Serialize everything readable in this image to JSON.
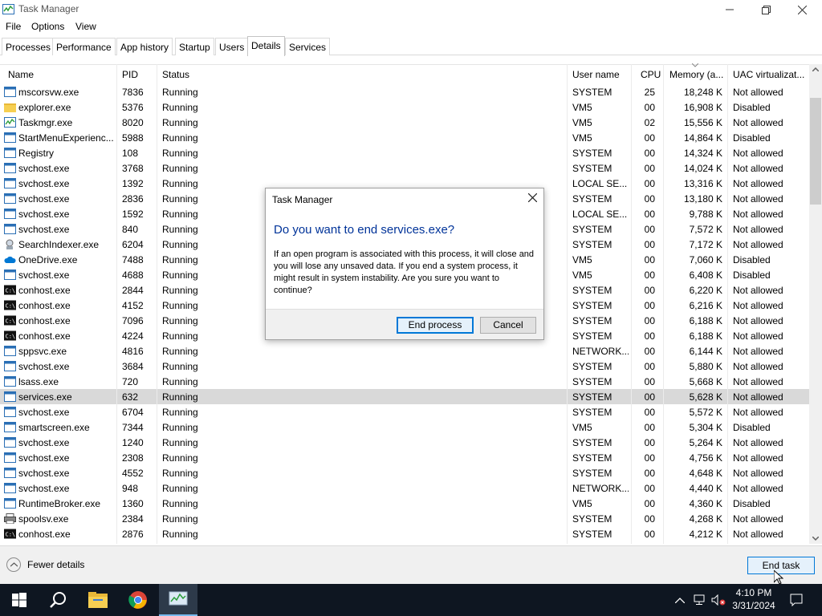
{
  "window": {
    "title": "Task Manager"
  },
  "menu": [
    "File",
    "Options",
    "View"
  ],
  "tabs": [
    "Processes",
    "Performance",
    "App history",
    "Startup",
    "Users",
    "Details",
    "Services"
  ],
  "active_tab": "Details",
  "columns": {
    "name": "Name",
    "pid": "PID",
    "status": "Status",
    "user": "User name",
    "cpu": "CPU",
    "memory": "Memory (a...",
    "uac": "UAC virtualizat..."
  },
  "rows": [
    {
      "icon": "app",
      "name": "mscorsvw.exe",
      "pid": "7836",
      "status": "Running",
      "user": "SYSTEM",
      "cpu": "25",
      "mem": "18,248 K",
      "uac": "Not allowed"
    },
    {
      "icon": "folder",
      "name": "explorer.exe",
      "pid": "5376",
      "status": "Running",
      "user": "VM5",
      "cpu": "00",
      "mem": "16,908 K",
      "uac": "Disabled"
    },
    {
      "icon": "taskmgr",
      "name": "Taskmgr.exe",
      "pid": "8020",
      "status": "Running",
      "user": "VM5",
      "cpu": "02",
      "mem": "15,556 K",
      "uac": "Not allowed"
    },
    {
      "icon": "app",
      "name": "StartMenuExperienc...",
      "pid": "5988",
      "status": "Running",
      "user": "VM5",
      "cpu": "00",
      "mem": "14,864 K",
      "uac": "Disabled"
    },
    {
      "icon": "app",
      "name": "Registry",
      "pid": "108",
      "status": "Running",
      "user": "SYSTEM",
      "cpu": "00",
      "mem": "14,324 K",
      "uac": "Not allowed"
    },
    {
      "icon": "app",
      "name": "svchost.exe",
      "pid": "3768",
      "status": "Running",
      "user": "SYSTEM",
      "cpu": "00",
      "mem": "14,024 K",
      "uac": "Not allowed"
    },
    {
      "icon": "app",
      "name": "svchost.exe",
      "pid": "1392",
      "status": "Running",
      "user": "LOCAL SE...",
      "cpu": "00",
      "mem": "13,316 K",
      "uac": "Not allowed"
    },
    {
      "icon": "app",
      "name": "svchost.exe",
      "pid": "2836",
      "status": "Running",
      "user": "SYSTEM",
      "cpu": "00",
      "mem": "13,180 K",
      "uac": "Not allowed"
    },
    {
      "icon": "app",
      "name": "svchost.exe",
      "pid": "1592",
      "status": "Running",
      "user": "LOCAL SE...",
      "cpu": "00",
      "mem": "9,788 K",
      "uac": "Not allowed"
    },
    {
      "icon": "app",
      "name": "svchost.exe",
      "pid": "840",
      "status": "Running",
      "user": "SYSTEM",
      "cpu": "00",
      "mem": "7,572 K",
      "uac": "Not allowed"
    },
    {
      "icon": "search",
      "name": "SearchIndexer.exe",
      "pid": "6204",
      "status": "Running",
      "user": "SYSTEM",
      "cpu": "00",
      "mem": "7,172 K",
      "uac": "Not allowed"
    },
    {
      "icon": "cloud",
      "name": "OneDrive.exe",
      "pid": "7488",
      "status": "Running",
      "user": "VM5",
      "cpu": "00",
      "mem": "7,060 K",
      "uac": "Disabled"
    },
    {
      "icon": "app",
      "name": "svchost.exe",
      "pid": "4688",
      "status": "Running",
      "user": "VM5",
      "cpu": "00",
      "mem": "6,408 K",
      "uac": "Disabled"
    },
    {
      "icon": "console",
      "name": "conhost.exe",
      "pid": "2844",
      "status": "Running",
      "user": "SYSTEM",
      "cpu": "00",
      "mem": "6,220 K",
      "uac": "Not allowed"
    },
    {
      "icon": "console",
      "name": "conhost.exe",
      "pid": "4152",
      "status": "Running",
      "user": "SYSTEM",
      "cpu": "00",
      "mem": "6,216 K",
      "uac": "Not allowed"
    },
    {
      "icon": "console",
      "name": "conhost.exe",
      "pid": "7096",
      "status": "Running",
      "user": "SYSTEM",
      "cpu": "00",
      "mem": "6,188 K",
      "uac": "Not allowed"
    },
    {
      "icon": "console",
      "name": "conhost.exe",
      "pid": "4224",
      "status": "Running",
      "user": "SYSTEM",
      "cpu": "00",
      "mem": "6,188 K",
      "uac": "Not allowed"
    },
    {
      "icon": "app",
      "name": "sppsvc.exe",
      "pid": "4816",
      "status": "Running",
      "user": "NETWORK...",
      "cpu": "00",
      "mem": "6,144 K",
      "uac": "Not allowed"
    },
    {
      "icon": "app",
      "name": "svchost.exe",
      "pid": "3684",
      "status": "Running",
      "user": "SYSTEM",
      "cpu": "00",
      "mem": "5,880 K",
      "uac": "Not allowed"
    },
    {
      "icon": "app",
      "name": "lsass.exe",
      "pid": "720",
      "status": "Running",
      "user": "SYSTEM",
      "cpu": "00",
      "mem": "5,668 K",
      "uac": "Not allowed"
    },
    {
      "icon": "app",
      "name": "services.exe",
      "pid": "632",
      "status": "Running",
      "user": "SYSTEM",
      "cpu": "00",
      "mem": "5,628 K",
      "uac": "Not allowed",
      "selected": true
    },
    {
      "icon": "app",
      "name": "svchost.exe",
      "pid": "6704",
      "status": "Running",
      "user": "SYSTEM",
      "cpu": "00",
      "mem": "5,572 K",
      "uac": "Not allowed"
    },
    {
      "icon": "app",
      "name": "smartscreen.exe",
      "pid": "7344",
      "status": "Running",
      "user": "VM5",
      "cpu": "00",
      "mem": "5,304 K",
      "uac": "Disabled"
    },
    {
      "icon": "app",
      "name": "svchost.exe",
      "pid": "1240",
      "status": "Running",
      "user": "SYSTEM",
      "cpu": "00",
      "mem": "5,264 K",
      "uac": "Not allowed"
    },
    {
      "icon": "app",
      "name": "svchost.exe",
      "pid": "2308",
      "status": "Running",
      "user": "SYSTEM",
      "cpu": "00",
      "mem": "4,756 K",
      "uac": "Not allowed"
    },
    {
      "icon": "app",
      "name": "svchost.exe",
      "pid": "4552",
      "status": "Running",
      "user": "SYSTEM",
      "cpu": "00",
      "mem": "4,648 K",
      "uac": "Not allowed"
    },
    {
      "icon": "app",
      "name": "svchost.exe",
      "pid": "948",
      "status": "Running",
      "user": "NETWORK...",
      "cpu": "00",
      "mem": "4,440 K",
      "uac": "Not allowed"
    },
    {
      "icon": "app",
      "name": "RuntimeBroker.exe",
      "pid": "1360",
      "status": "Running",
      "user": "VM5",
      "cpu": "00",
      "mem": "4,360 K",
      "uac": "Disabled"
    },
    {
      "icon": "printer",
      "name": "spoolsv.exe",
      "pid": "2384",
      "status": "Running",
      "user": "SYSTEM",
      "cpu": "00",
      "mem": "4,268 K",
      "uac": "Not allowed"
    },
    {
      "icon": "console",
      "name": "conhost.exe",
      "pid": "2876",
      "status": "Running",
      "user": "SYSTEM",
      "cpu": "00",
      "mem": "4,212 K",
      "uac": "Not allowed"
    }
  ],
  "footer": {
    "fewer_details": "Fewer details",
    "end_task": "End task"
  },
  "dialog": {
    "title": "Task Manager",
    "heading": "Do you want to end services.exe?",
    "message": "If an open program is associated with this process, it will close and you will lose any unsaved data. If you end a system process, it might result in system instability. Are you sure you want to continue?",
    "confirm": "End process",
    "cancel": "Cancel"
  },
  "taskbar": {
    "time": "4:10 PM",
    "date": "3/31/2024",
    "apps": [
      "start-icon",
      "search-icon",
      "file-explorer-icon",
      "chrome-icon",
      "task-manager-icon"
    ]
  },
  "colors": {
    "accent": "#0078d7",
    "heading": "#003399",
    "taskbar": "#0e1621",
    "selected_row": "#d9d9d9"
  }
}
